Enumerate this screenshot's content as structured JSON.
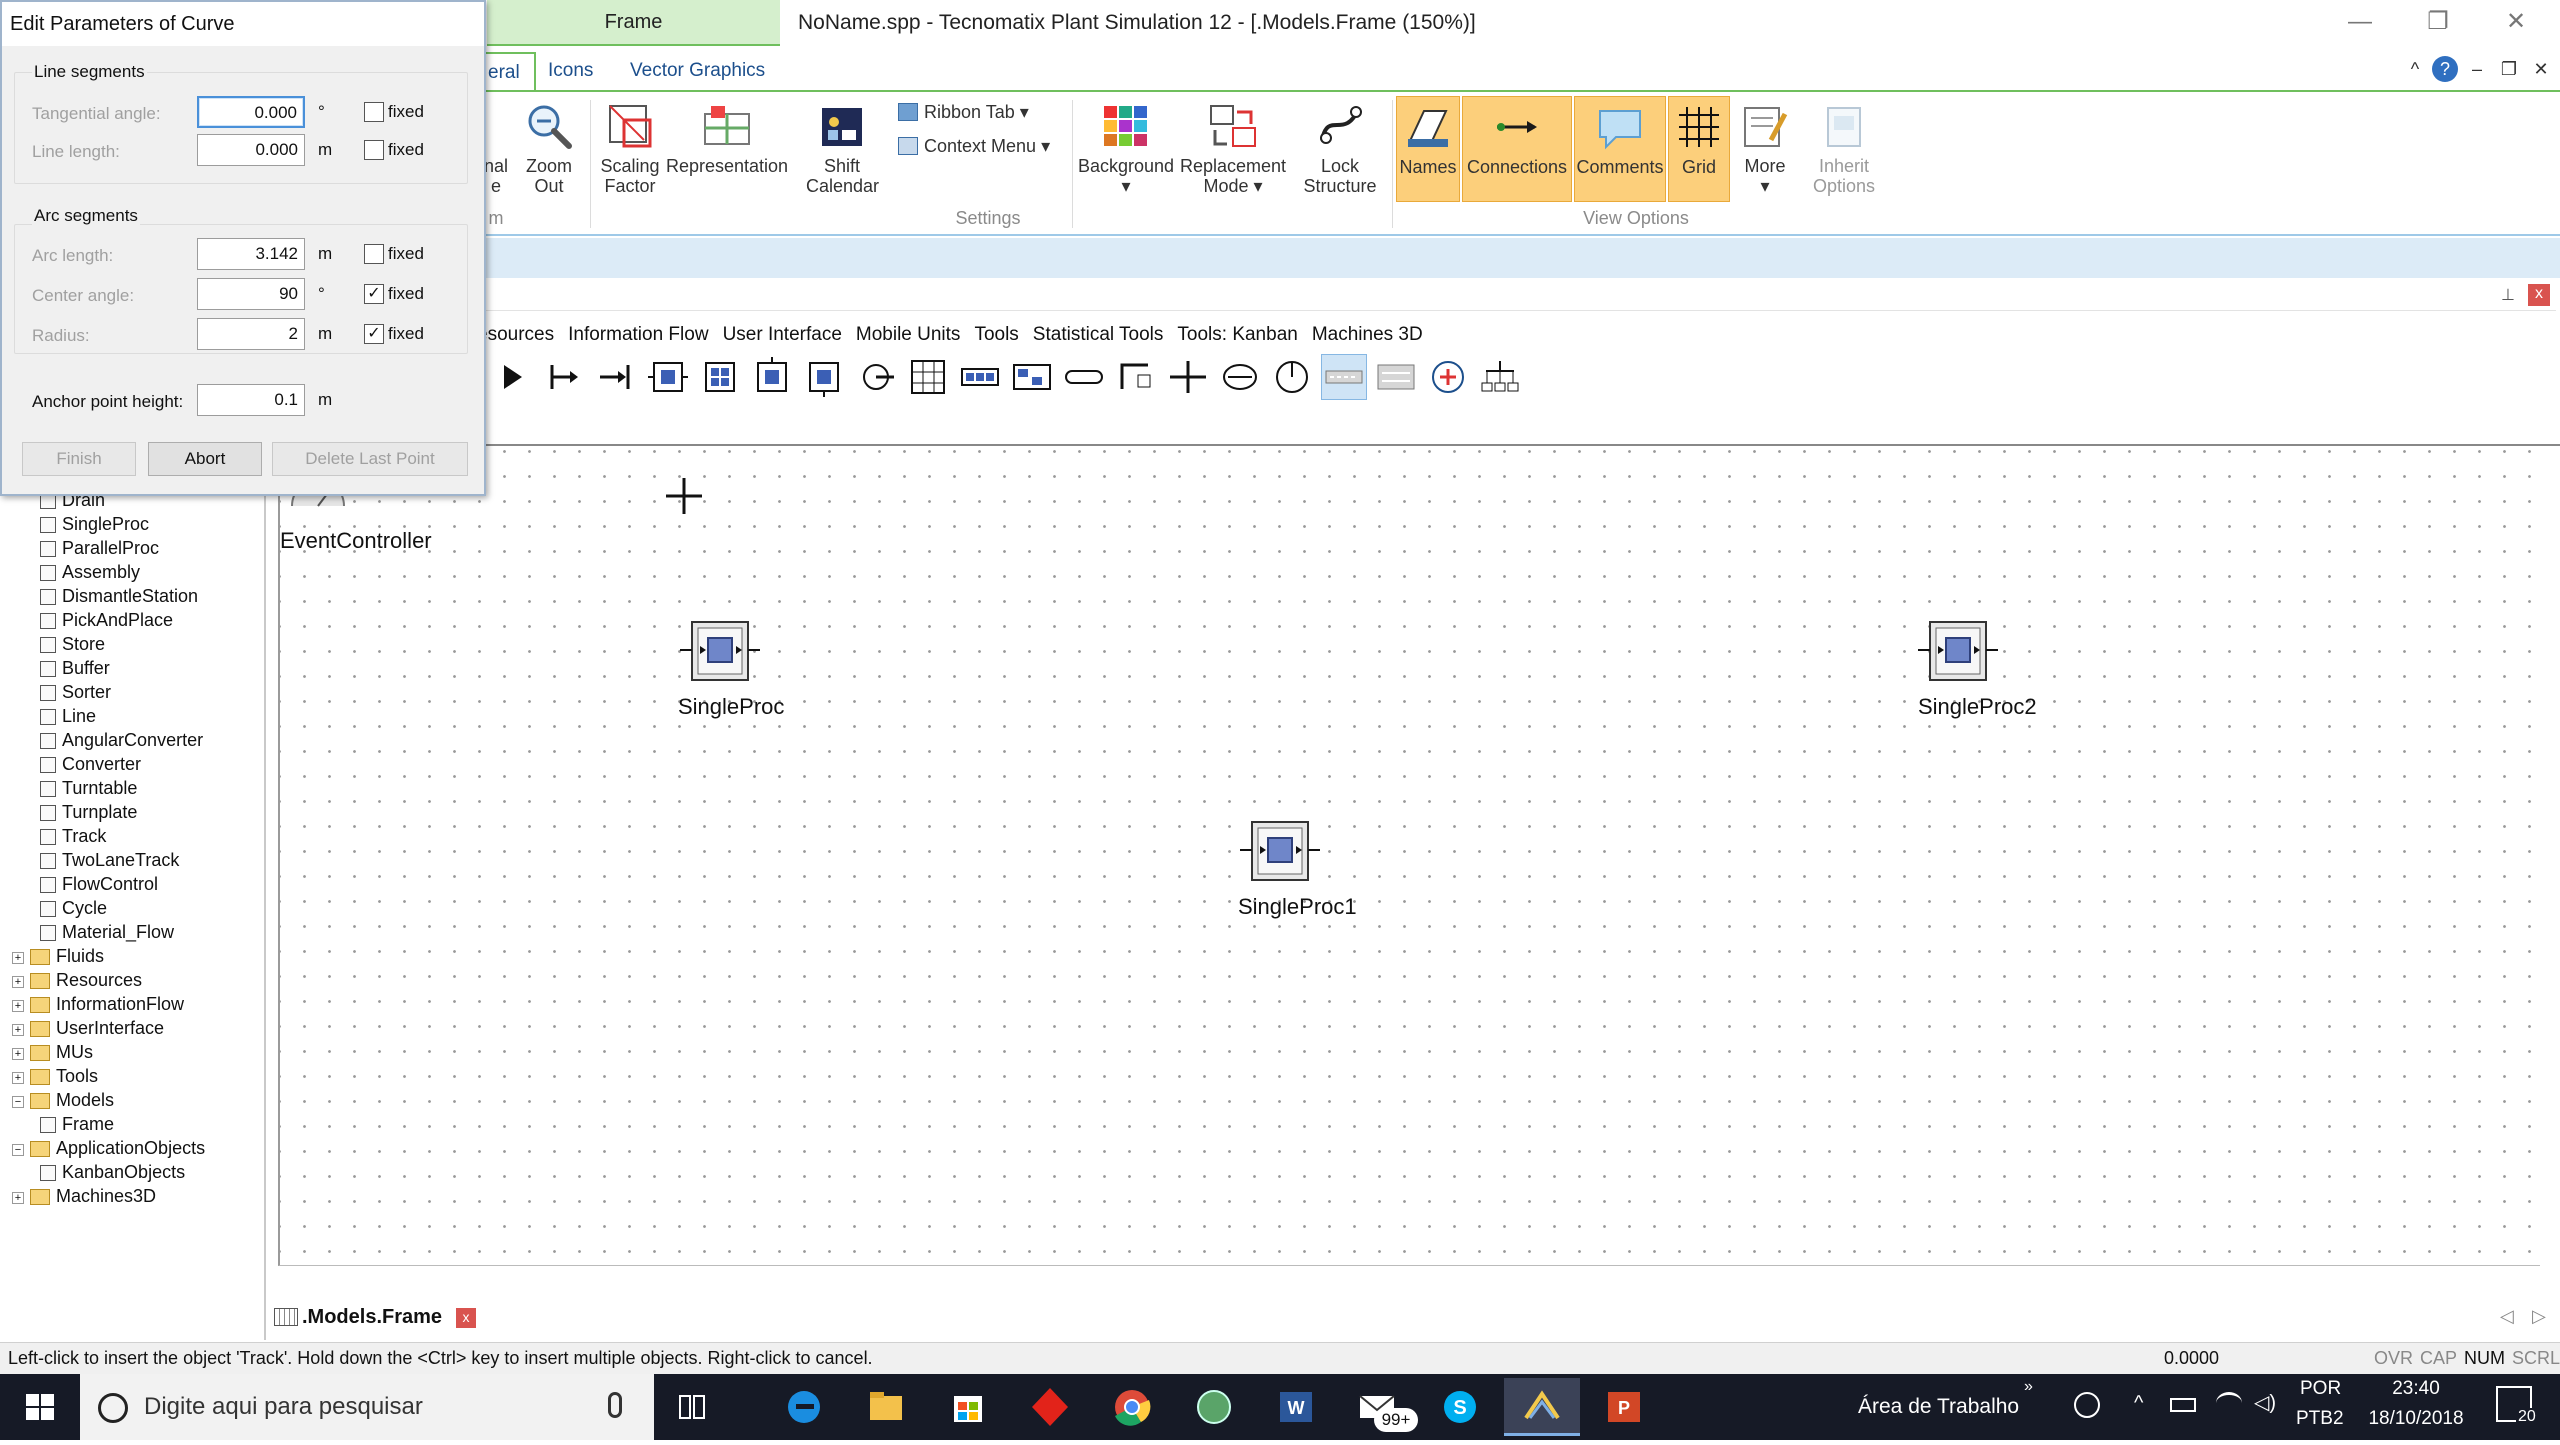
{
  "window": {
    "context_tab": "Frame",
    "title": "NoName.spp - Tecnomatix Plant Simulation 12 - [.Models.Frame  (150%)]",
    "controls": {
      "minimize": "—",
      "restore": "❐",
      "close": "✕"
    }
  },
  "ribbon_tabs": [
    {
      "label": "eral",
      "active": true
    },
    {
      "label": "Icons",
      "active": false
    },
    {
      "label": "Vector Graphics",
      "active": false
    }
  ],
  "ribbon_controls": {
    "collapse": "^",
    "help": "?",
    "min": "–",
    "restore": "❐",
    "close": "✕"
  },
  "ribbon": {
    "partial_left": {
      "line1": "nal",
      "line2": "e",
      "group_label": "m"
    },
    "zoom_out": {
      "line1": "Zoom",
      "line2": "Out"
    },
    "scaling": {
      "line1": "Scaling",
      "line2": "Factor"
    },
    "representation": {
      "line1": "Representation"
    },
    "shift_calendar": {
      "line1": "Shift",
      "line2": "Calendar"
    },
    "ribbon_tab": "Ribbon Tab",
    "context_menu": "Context Menu",
    "settings_label": "Settings",
    "background": {
      "line1": "Background"
    },
    "replacement": {
      "line1": "Replacement",
      "line2": "Mode"
    },
    "lock": {
      "line1": "Lock",
      "line2": "Structure"
    },
    "names": "Names",
    "connections": "Connections",
    "comments": "Comments",
    "grid": "Grid",
    "more": "More",
    "inherit": {
      "line1": "Inherit",
      "line2": "Options"
    },
    "view_options_label": "View Options"
  },
  "toolbox": {
    "pin": "⊥",
    "close": "x",
    "tabs": [
      "esources",
      "Information Flow",
      "User Interface",
      "Mobile Units",
      "Tools",
      "Statistical Tools",
      "Tools: Kanban",
      "Machines 3D"
    ]
  },
  "tree": {
    "items": [
      {
        "label": "Drain",
        "indent": 2
      },
      {
        "label": "SingleProc",
        "indent": 2
      },
      {
        "label": "ParallelProc",
        "indent": 2
      },
      {
        "label": "Assembly",
        "indent": 2
      },
      {
        "label": "DismantleStation",
        "indent": 2
      },
      {
        "label": "PickAndPlace",
        "indent": 2
      },
      {
        "label": "Store",
        "indent": 2
      },
      {
        "label": "Buffer",
        "indent": 2
      },
      {
        "label": "Sorter",
        "indent": 2
      },
      {
        "label": "Line",
        "indent": 2
      },
      {
        "label": "AngularConverter",
        "indent": 2
      },
      {
        "label": "Converter",
        "indent": 2
      },
      {
        "label": "Turntable",
        "indent": 2
      },
      {
        "label": "Turnplate",
        "indent": 2
      },
      {
        "label": "Track",
        "indent": 2
      },
      {
        "label": "TwoLaneTrack",
        "indent": 2
      },
      {
        "label": "FlowControl",
        "indent": 2
      },
      {
        "label": "Cycle",
        "indent": 2
      },
      {
        "label": "Material_Flow",
        "indent": 2
      },
      {
        "label": "Fluids",
        "indent": 1,
        "folder": true
      },
      {
        "label": "Resources",
        "indent": 1,
        "folder": true
      },
      {
        "label": "InformationFlow",
        "indent": 1,
        "folder": true
      },
      {
        "label": "UserInterface",
        "indent": 1,
        "folder": true
      },
      {
        "label": "MUs",
        "indent": 1,
        "folder": true
      },
      {
        "label": "Tools",
        "indent": 1,
        "folder": true
      },
      {
        "label": "Models",
        "indent": 1,
        "folder": true
      },
      {
        "label": "Frame",
        "indent": 2
      },
      {
        "label": "ApplicationObjects",
        "indent": 1,
        "folder": true
      },
      {
        "label": "KanbanObjects",
        "indent": 2
      },
      {
        "label": "Machines3D",
        "indent": 1,
        "folder": true
      }
    ]
  },
  "canvas": {
    "event_controller": "EventController",
    "objects": [
      {
        "name": "SingleProc"
      },
      {
        "name": "SingleProc2"
      },
      {
        "name": "SingleProc1"
      }
    ]
  },
  "doc_tab": {
    "label": ".Models.Frame",
    "close": "x"
  },
  "nav_arrows": {
    "prev": "◁",
    "next": "▷"
  },
  "status": {
    "message": "Left-click to insert the object 'Track'. Hold down the <Ctrl> key to insert multiple objects. Right-click to cancel.",
    "coord": "0.0000",
    "ovr": "OVR",
    "cap": "CAP",
    "num": "NUM",
    "scrl": "SCRL"
  },
  "taskbar": {
    "search_placeholder": "Digite aqui para pesquisar",
    "desktop": "Área de Trabalho",
    "lang1": "POR",
    "lang2": "PTB2",
    "time": "23:40",
    "date": "18/10/2018",
    "badge": "99+",
    "notif_count": "20"
  },
  "dialog": {
    "title": "Edit Parameters of Curve",
    "line_segments": "Line segments",
    "tangential_label": "Tangential angle:",
    "tangential_value": "0.000",
    "tangential_unit": "°",
    "line_length_label": "Line length:",
    "line_length_value": "0.000",
    "line_length_unit": "m",
    "arc_segments": "Arc segments",
    "arc_length_label": "Arc length:",
    "arc_length_value": "3.142",
    "arc_length_unit": "m",
    "center_angle_label": "Center angle:",
    "center_angle_value": "90",
    "center_angle_unit": "°",
    "radius_label": "Radius:",
    "radius_value": "2",
    "radius_unit": "m",
    "anchor_label": "Anchor point height:",
    "anchor_value": "0.1",
    "anchor_unit": "m",
    "fixed": "fixed",
    "checks": {
      "tangential": false,
      "line_length": false,
      "arc_length": false,
      "center_angle": true,
      "radius": true
    },
    "check_mark": "✓",
    "finish": "Finish",
    "abort": "Abort",
    "delete_last": "Delete Last Point"
  }
}
